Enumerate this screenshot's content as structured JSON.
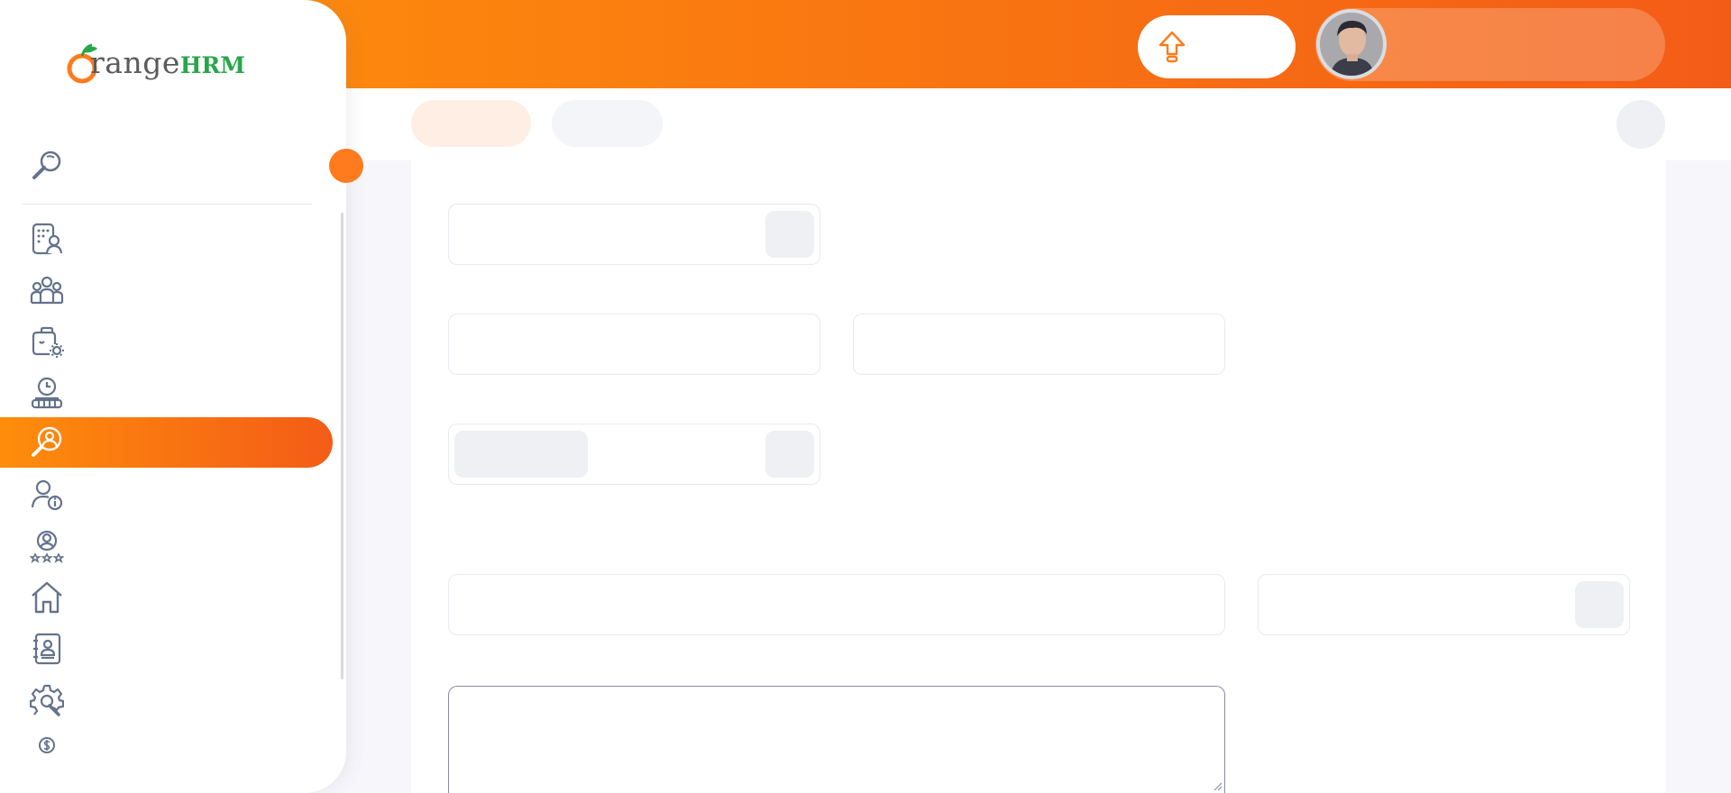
{
  "brand": {
    "name_part": "range",
    "hrm_part": "HRM",
    "orange_color": "#ff7b1d",
    "green_color": "#28a64a"
  },
  "header": {
    "upgrade_icon": "upgrade-arrow-icon",
    "avatar_icon": "user-avatar"
  },
  "colors": {
    "accent": "#ff7b1d",
    "header_gradient_start": "#ff920b",
    "header_gradient_end": "#f35c17",
    "icon_stroke": "#64728c"
  },
  "sidebar": {
    "items": [
      {
        "id": "search",
        "icon": "search-icon"
      },
      {
        "id": "admin",
        "icon": "admin-icon"
      },
      {
        "id": "pim",
        "icon": "employees-icon"
      },
      {
        "id": "leave",
        "icon": "leave-icon"
      },
      {
        "id": "time",
        "icon": "time-icon"
      },
      {
        "id": "recruitment",
        "icon": "recruitment-icon",
        "active": true
      },
      {
        "id": "my-info",
        "icon": "my-info-icon"
      },
      {
        "id": "performance",
        "icon": "performance-icon"
      },
      {
        "id": "dashboard",
        "icon": "home-icon"
      },
      {
        "id": "directory",
        "icon": "directory-icon"
      },
      {
        "id": "maintenance",
        "icon": "maintenance-icon"
      },
      {
        "id": "claim",
        "icon": "claim-icon"
      }
    ]
  }
}
